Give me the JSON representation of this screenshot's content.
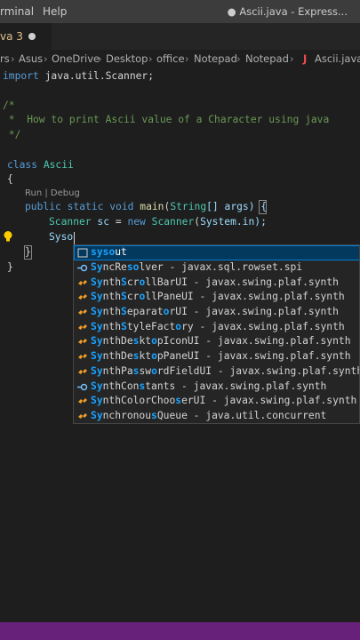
{
  "menubar": {
    "items": [
      "rminal",
      "Help"
    ],
    "title": "● Ascii.java - Express..."
  },
  "tab": {
    "label": "va 3"
  },
  "breadcrumb": [
    "rs",
    "Asus",
    "OneDrive",
    "Desktop",
    "office",
    "Notepad",
    "Notepad",
    "Ascii.java"
  ],
  "code": {
    "line1": {
      "kw": "import",
      "rest": " java.util.Scanner;"
    },
    "line3": "/*",
    "line4": " *  How to print Ascii value of a Character using java",
    "line5": " */",
    "line8": {
      "kw": "class",
      "name": "Ascii"
    },
    "line9": "{",
    "codelens": "Run | Debug",
    "line10": {
      "kw1": "public",
      "kw2": "static",
      "kw3": "void",
      "fn": "main",
      "ty": "String",
      "rest": "[] args) {"
    },
    "line11": {
      "ty": "Scanner",
      "var": "sc",
      "kw": "new",
      "ty2": "Scanner",
      "rest": "System.in);"
    },
    "line12": "Syso",
    "line13": "}",
    "line14": "}"
  },
  "suggest": {
    "items": [
      {
        "label": "sysout",
        "icon": "snippet-icon",
        "selected": true
      },
      {
        "label": "SyncResolver - javax.sql.rowset.spi",
        "icon": "interface-icon"
      },
      {
        "label": "SynthScrollBarUI - javax.swing.plaf.synth",
        "icon": "class-icon"
      },
      {
        "label": "SynthScrollPaneUI - javax.swing.plaf.synth",
        "icon": "class-icon"
      },
      {
        "label": "SynthSeparatorUI - javax.swing.plaf.synth",
        "icon": "class-icon"
      },
      {
        "label": "SynthStyleFactory - javax.swing.plaf.synth",
        "icon": "class-icon"
      },
      {
        "label": "SynthDesktopIconUI - javax.swing.plaf.synth",
        "icon": "class-icon"
      },
      {
        "label": "SynthDesktopPaneUI - javax.swing.plaf.synth",
        "icon": "class-icon"
      },
      {
        "label": "SynthPasswordFieldUI - javax.swing.plaf.synth",
        "icon": "class-icon"
      },
      {
        "label": "SynthConstants - javax.swing.plaf.synth",
        "icon": "interface-icon"
      },
      {
        "label": "SynthColorChooserUI - javax.swing.plaf.synth",
        "icon": "class-icon"
      },
      {
        "label": "SynchronousQueue - java.util.concurrent",
        "icon": "class-icon"
      }
    ]
  },
  "colors": {
    "statusbar": "#68217a",
    "selection": "#04395e",
    "highlight": "#18a3ff"
  }
}
